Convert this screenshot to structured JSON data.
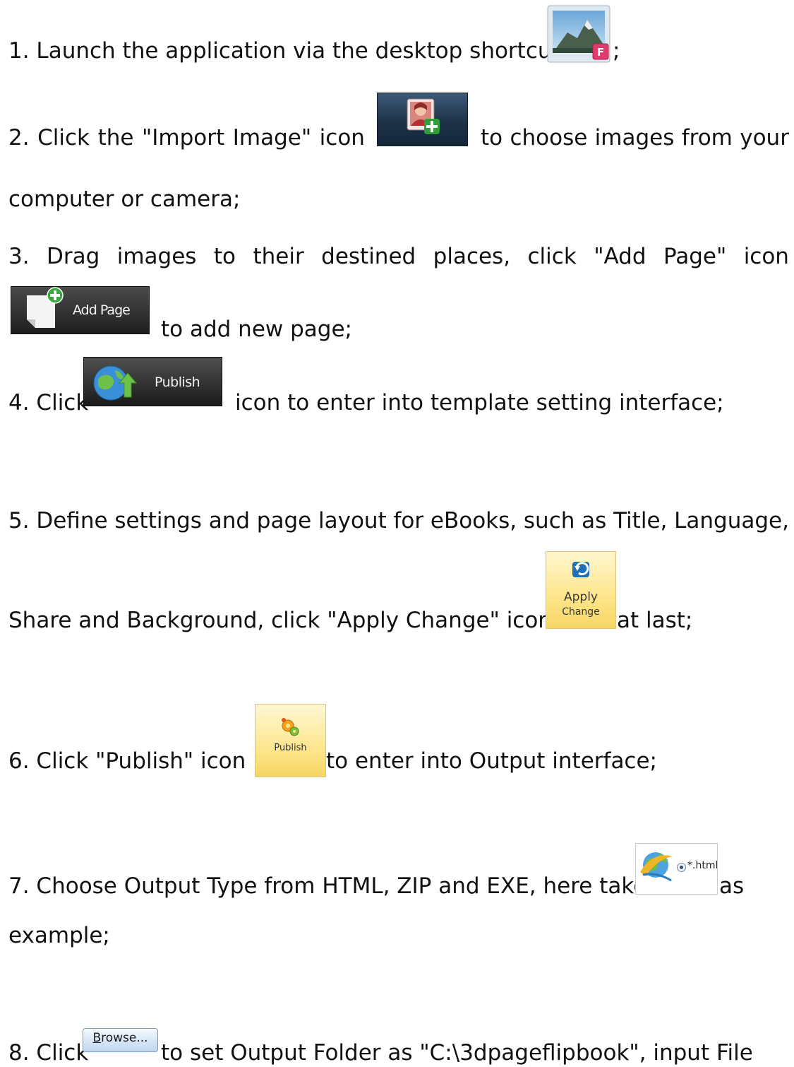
{
  "steps": {
    "step1": {
      "text": "1. Launch the application via the desktop shortcut",
      "suffix": ";"
    },
    "step2": {
      "w": [
        "2.",
        "Click",
        "the",
        "\"Import",
        "Image\"",
        "icon"
      ],
      "after": [
        "to",
        "choose",
        "images",
        "from",
        "your"
      ],
      "line2": "computer or camera;"
    },
    "step3": {
      "w": [
        "3.",
        "Drag",
        "images",
        "to",
        "their",
        "destined",
        "places,",
        "click",
        "\"Add",
        "Page\"",
        "icon"
      ],
      "after": "to add new page;",
      "icon_label": "Add Page"
    },
    "step4": {
      "before": "4. Click",
      "after": "icon to enter into template setting interface;",
      "icon_label": "Publish"
    },
    "step5": {
      "w": [
        "5.",
        "Define",
        "settings",
        "and",
        "page",
        "layout",
        "for",
        "eBooks,",
        "such",
        "as",
        "Title,",
        "Language,"
      ],
      "line2": "Share and Background, click \"Apply Change\" icon",
      "after": "at last;",
      "icon_label_1": "Apply",
      "icon_label_2": "Change"
    },
    "step6": {
      "before": "6. Click \"Publish\" icon",
      "after": "to enter into Output interface;",
      "icon_label": "Publish"
    },
    "step7": {
      "before": "7. Choose Output Type from HTML, ZIP and EXE, here take",
      "after": "as",
      "line2": "example;",
      "icon_label": "*.html"
    },
    "step8": {
      "before": "8. Click",
      "after": "to set Output Folder as \"C:\\3dpageflipbook\", input File",
      "icon_label": "Browse..."
    }
  },
  "colors": {
    "text": "#111111",
    "dark_button": "#1e1e1e",
    "ribbon_yellow": "#fde58a",
    "browse_blue": "#c2d8ee"
  }
}
